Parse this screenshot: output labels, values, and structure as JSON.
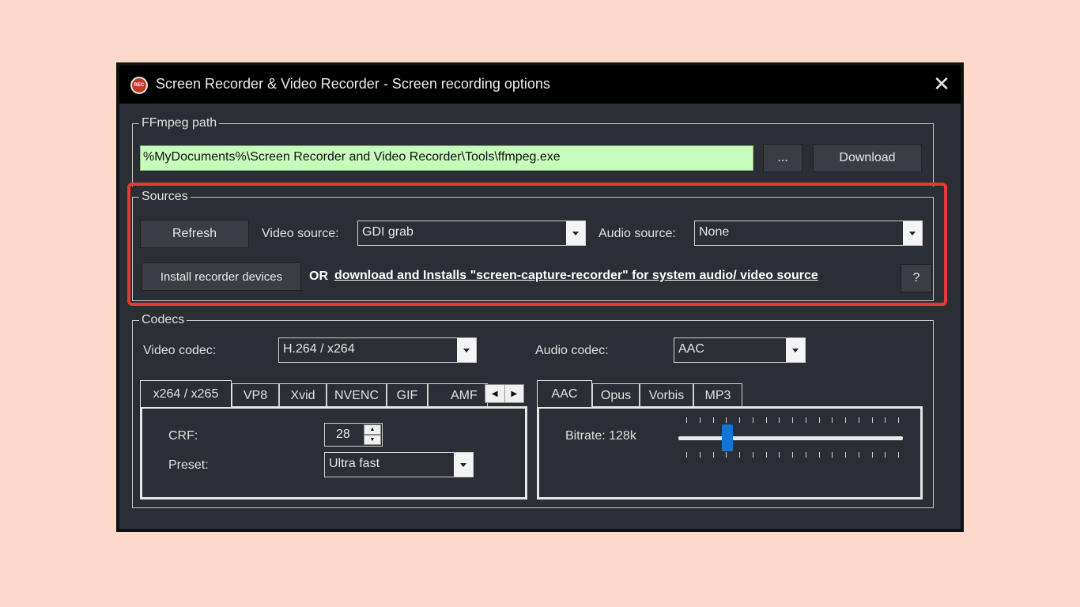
{
  "window": {
    "title": "Screen Recorder & Video Recorder - Screen recording options",
    "app_icon_text": "REC",
    "close_glyph": "✕"
  },
  "ffmpeg": {
    "group_label": "FFmpeg path",
    "path_value": "%MyDocuments%\\Screen Recorder and Video Recorder\\Tools\\ffmpeg.exe",
    "browse_label": "...",
    "download_label": "Download"
  },
  "sources": {
    "group_label": "Sources",
    "refresh_label": "Refresh",
    "video_source_label": "Video source:",
    "video_source_value": "GDI grab",
    "audio_source_label": "Audio source:",
    "audio_source_value": "None",
    "install_label": "Install recorder devices",
    "or_text": "OR",
    "link_text": "download and Installs \"screen-capture-recorder\" for system audio/ video source",
    "help_label": "?",
    "highlight_color": "#e53935"
  },
  "codecs": {
    "group_label": "Codecs",
    "video_codec_label": "Video codec:",
    "video_codec_value": "H.264 / x264",
    "audio_codec_label": "Audio codec:",
    "audio_codec_value": "AAC",
    "video_tabs": [
      "x264 / x265",
      "VP8",
      "Xvid",
      "NVENC",
      "GIF",
      "AMF"
    ],
    "video_active_tab": "x264 / x265",
    "scroll_left": "◀",
    "scroll_right": "▶",
    "crf_label": "CRF:",
    "crf_value": "28",
    "spin_up": "▲",
    "spin_down": "▼",
    "preset_label": "Preset:",
    "preset_value": "Ultra fast",
    "audio_tabs": [
      "AAC",
      "Opus",
      "Vorbis",
      "MP3"
    ],
    "audio_active_tab": "AAC",
    "bitrate_label": "Bitrate: 128k",
    "bitrate_slider_fraction": 0.22
  },
  "colors": {
    "page_background": "#fdd9ca",
    "window_background": "#2b2e35",
    "path_field_background": "#c8fcbc",
    "slider_thumb": "#1474d4"
  }
}
